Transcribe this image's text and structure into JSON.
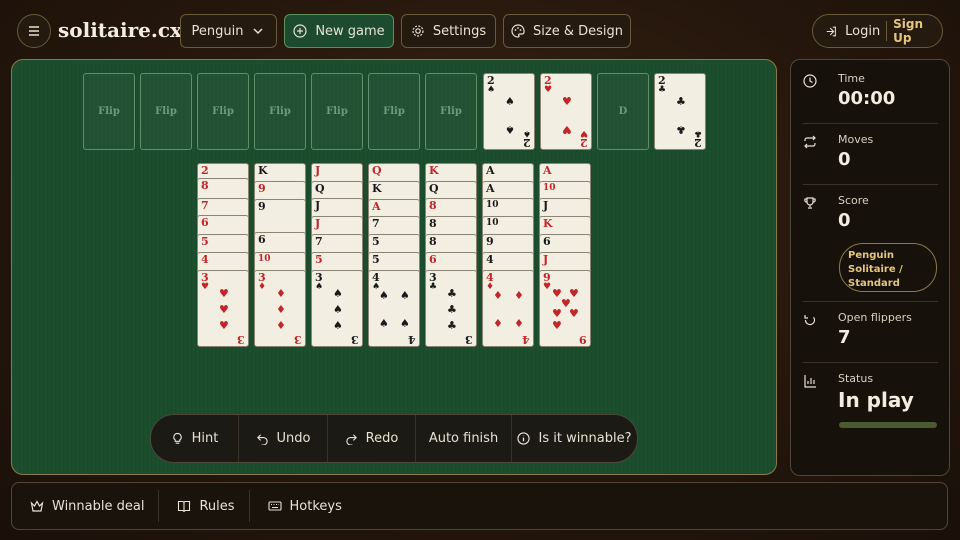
{
  "header": {
    "logo": "solitaire.cx",
    "variant_label": "Penguin",
    "new_game_label": "New game",
    "settings_label": "Settings",
    "size_design_label": "Size & Design",
    "login_label": "Login",
    "signup_label": "Sign Up"
  },
  "slot_label": "Flip",
  "foundation_label": "D",
  "tableau": {
    "col1": {
      "top": "2",
      "s2": "8",
      "s3": "7",
      "s4": "6",
      "s5": "5",
      "s6": "4",
      "face": "3"
    },
    "col2": {
      "top": "K",
      "s2": "9",
      "s3": "9",
      "s4": "6",
      "s5": "10",
      "face": "3"
    },
    "col3": {
      "top": "J",
      "s2": "Q",
      "s3": "J",
      "s4": "7",
      "s5": "5",
      "face": "3"
    },
    "col4": {
      "top": "Q",
      "s2": "K",
      "s3": "A",
      "s4": "7",
      "s5": "5",
      "face": "4"
    },
    "col5": {
      "top": "K",
      "s2": "Q",
      "s3": "8",
      "s4": "8",
      "s5": "6",
      "face": "3"
    },
    "col6": {
      "top": "A",
      "s2": "A",
      "s3": "10",
      "s4": "9",
      "s5": "4",
      "face": "4"
    },
    "col7": {
      "top": "A",
      "s2": "10",
      "s3": "J",
      "s4": "K",
      "s5": "6",
      "s6": "J",
      "face": "9"
    },
    "foundation_1": "2",
    "foundation_2": "2",
    "foundation_3": "2"
  },
  "toolbar": {
    "hint": "Hint",
    "undo": "Undo",
    "redo": "Redo",
    "auto_finish": "Auto finish",
    "winnable": "Is it winnable?"
  },
  "sidebar": {
    "time_label": "Time",
    "time_value": "00:00",
    "moves_label": "Moves",
    "moves_value": "0",
    "score_label": "Score",
    "score_value": "0",
    "mode_badge": "Penguin Solitaire / Standard",
    "flippers_label": "Open flippers",
    "flippers_value": "7",
    "status_label": "Status",
    "status_value": "In play"
  },
  "footer": {
    "winnable_deal": "Winnable deal",
    "rules": "Rules",
    "hotkeys": "Hotkeys"
  },
  "colors": {
    "felt": "#1a4a2c",
    "accent_gold": "#e4c77c",
    "new_game_bg": "#1c4b30"
  }
}
